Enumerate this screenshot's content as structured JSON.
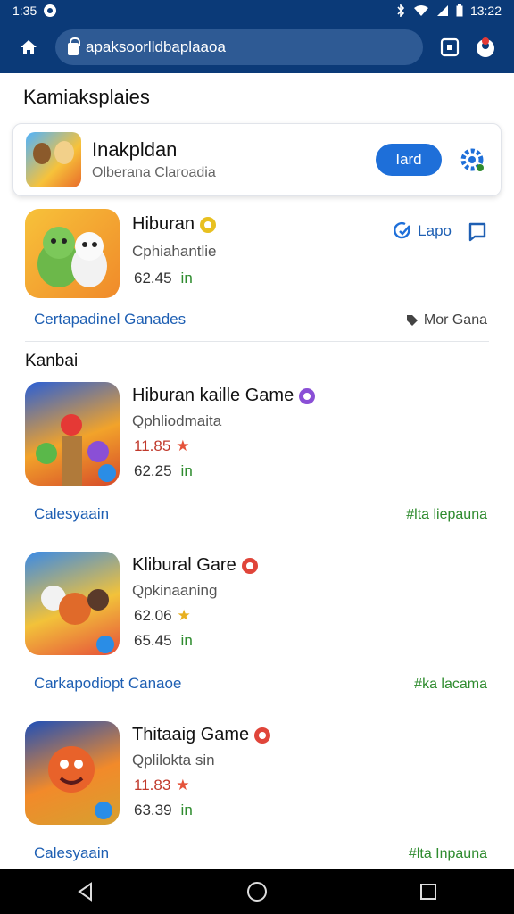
{
  "status": {
    "time": "1:35",
    "clock": "13:22"
  },
  "browser": {
    "url": "apaksoorlldbaplaaoa"
  },
  "page": {
    "title": "Kamiaksplaies"
  },
  "featured": {
    "title": "Inakpldan",
    "subtitle": "Olberana Claroadia",
    "button": "Iard"
  },
  "top_app": {
    "title": "Hiburan",
    "subtitle": "Cphiahantlie",
    "price": "62.45",
    "price_tag": "in",
    "action1": "Lapo",
    "link_left": "Certapadinel Ganades",
    "link_right": "Mor Gana"
  },
  "section": {
    "label": "Kanbai"
  },
  "apps": [
    {
      "title": "Hiburan kaille Game",
      "subtitle": "Qphliodmaita",
      "rating": "11.85",
      "price": "62.25",
      "price_tag": "in",
      "link_left": "Calesyaain",
      "link_right": "#lta liepauna",
      "badge_color": "#8a4fd6",
      "icon_colors": [
        "#2a5fd6",
        "#f2a32a",
        "#d64a2a"
      ]
    },
    {
      "title": "Klibural Gare",
      "subtitle": "Qpkinaaning",
      "rating": "62.06",
      "price": "65.45",
      "price_tag": "in",
      "link_left": "Carkapodiopt Canaoe",
      "link_right": "#ka lacama",
      "badge_color": "#e0453a",
      "icon_colors": [
        "#3a8ae6",
        "#f2c23a",
        "#e6503a"
      ]
    },
    {
      "title": "Thitaaig Game",
      "subtitle": "Qplilokta sin",
      "rating": "11.83",
      "price": "63.39",
      "price_tag": "in",
      "link_left": "Calesyaain",
      "link_right": "#lta Inpauna",
      "badge_color": "#e0453a",
      "icon_colors": [
        "#1e4fb8",
        "#f28a2a",
        "#d6a030"
      ]
    }
  ]
}
